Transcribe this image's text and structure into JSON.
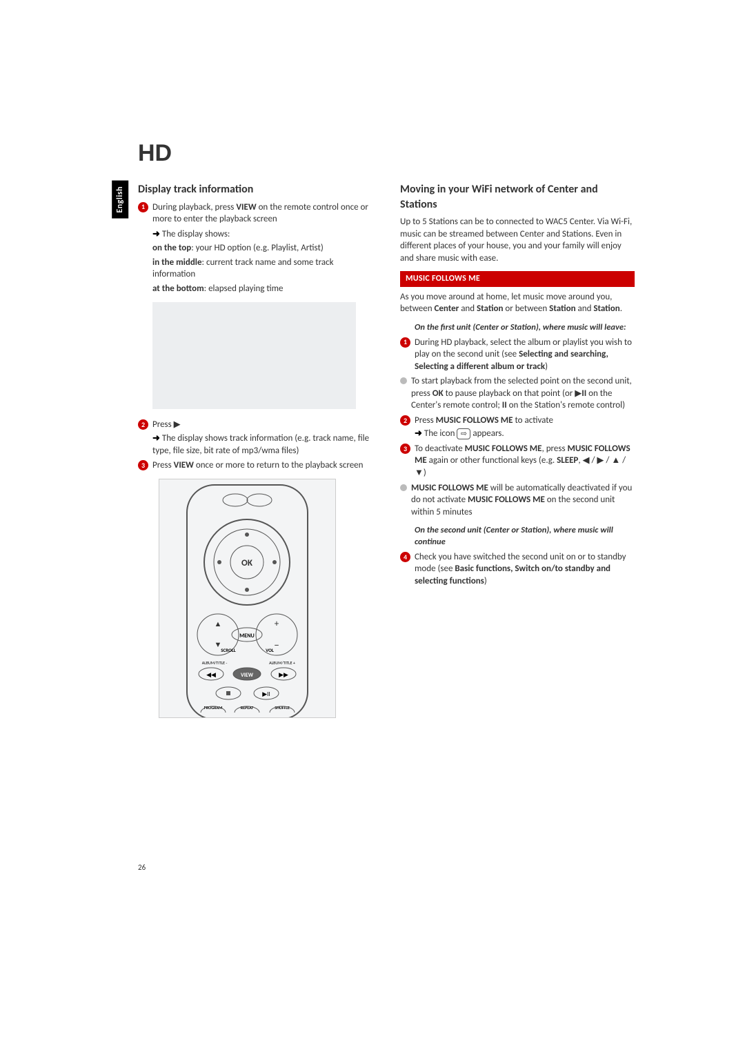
{
  "sideTab": "English",
  "pageHeader": "HD",
  "pageNumber": "26",
  "left": {
    "sectionTitle": "Display track information",
    "step1": {
      "text_a": "During playback, press ",
      "bold1": "VIEW",
      "text_b": " on the remote control once or more to enter the playback screen",
      "arrowLine": "The display shows:",
      "line_top_a": "on the top",
      "line_top_b": ": your HD option (e.g. Playlist, Artist)",
      "line_mid_a": "in the middle",
      "line_mid_b": ": current track name and some track information",
      "line_bot_a": "at the bottom",
      "line_bot_b": ": elapsed playing time"
    },
    "step2": {
      "text_a": "Press ",
      "arrowLine": "The display shows track information (e.g. track name, file type, file size, bit rate of mp3/wma files)"
    },
    "step3": {
      "text_a": "Press ",
      "bold1": "VIEW",
      "text_b": " once or more to return to the playback screen"
    },
    "remote": {
      "ok": "OK",
      "menu": "MENU",
      "scroll": "SCROLL",
      "vol": "VOL",
      "albL": "ALBUM/TITLE -",
      "albR": "ALBUM/TITLE +",
      "view": "VIEW",
      "program": "PROGRAM",
      "repeat": "REPEAT",
      "shuffle": "SHUFFLE"
    }
  },
  "right": {
    "sectionTitle": "Moving in your WiFi network of Center and Stations",
    "intro": "Up to 5 Stations can be to connected to WAC5 Center. Via Wi-Fi,  music can be streamed between Center and Stations. Even in different places of your house, you and your family will enjoy and share music with ease.",
    "barTitle": "MUSIC FOLLOWS ME",
    "para1_a": "As you move around at home, let music move around you, between ",
    "para1_b": "Center",
    "para1_c": " and ",
    "para1_d": "Station",
    "para1_e": " or between ",
    "para1_f": "Station",
    "para1_g": " and ",
    "para1_h": "Station",
    "para1_i": ".",
    "ital1": "On the first unit (Center or Station), where music will leave:",
    "s1_a": "During HD playback, select the album or playlist you wish to play on the second unit (see ",
    "s1_b": "Selecting and searching, Selecting a different album or track",
    "s1_c": ")",
    "bul1_a": "To start playback from the selected point on the second unit,  press ",
    "bul1_b": "OK",
    "bul1_c": " to pause playback on that point (or  ▶",
    "bul1_pause": "II",
    "bul1_d": " on the Center's remote control;  ",
    "bul1_pause2": "II",
    "bul1_e": " on the Station's remote control)",
    "s2_a": "Press ",
    "s2_b": "MUSIC FOLLOWS ME",
    "s2_c": " to activate",
    "s2_arrow_a": "The icon ",
    "s2_arrow_b": " appears.",
    "s3_a": "To deactivate ",
    "s3_b": "MUSIC FOLLOWS ME",
    "s3_c": ", press ",
    "s3_d": "MUSIC FOLLOWS ME",
    "s3_e": " again or other functional keys (e.g. ",
    "s3_f": "SLEEP",
    "s3_g": ", ◀ / ▶ / ▲ / ▼)",
    "bul2_a": "MUSIC FOLLOWS ME",
    "bul2_b": " will be automatically deactivated if you do not activate ",
    "bul2_c": "MUSIC FOLLOWS ME",
    "bul2_d": " on the second unit within 5 minutes",
    "ital2": "On the second unit (Center or Station), where music will continue",
    "s4_a": "Check you have switched the second unit on or to standby mode (see ",
    "s4_b": "Basic functions, Switch on/to standby and selecting functions",
    "s4_c": ")"
  }
}
